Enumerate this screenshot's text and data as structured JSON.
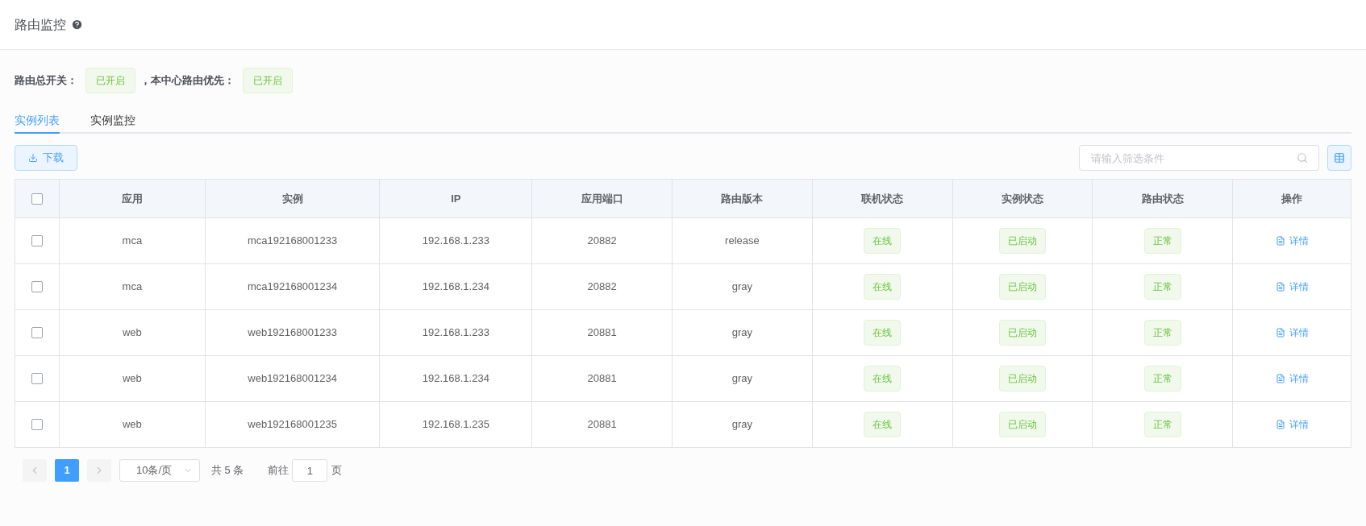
{
  "page": {
    "title": "路由监控"
  },
  "switches": [
    {
      "label": "路由总开关：",
      "value": "已开启"
    },
    {
      "label": "，本中心路由优先：",
      "value": "已开启"
    }
  ],
  "tabs": [
    {
      "label": "实例列表",
      "selected": true
    },
    {
      "label": "实例监控",
      "selected": false
    }
  ],
  "toolbar": {
    "download": "下载",
    "search": {
      "placeholder": "请输入筛选条件"
    }
  },
  "table": {
    "select_all": {
      "checked": false
    },
    "columns": [
      "应用",
      "实例",
      "IP",
      "应用端口",
      "路由版本",
      "联机状态",
      "实例状态",
      "路由状态",
      "操作"
    ],
    "rows": [
      {
        "checked": false,
        "cells": [
          "mca",
          "mca192168001233",
          "192.168.1.233",
          "20882",
          "release"
        ],
        "tags": [
          "在线",
          "已启动",
          "正常"
        ],
        "action": "详情"
      },
      {
        "checked": false,
        "cells": [
          "mca",
          "mca192168001234",
          "192.168.1.234",
          "20882",
          "gray"
        ],
        "tags": [
          "在线",
          "已启动",
          "正常"
        ],
        "action": "详情"
      },
      {
        "checked": false,
        "cells": [
          "web",
          "web192168001233",
          "192.168.1.233",
          "20881",
          "gray"
        ],
        "tags": [
          "在线",
          "已启动",
          "正常"
        ],
        "action": "详情"
      },
      {
        "checked": false,
        "cells": [
          "web",
          "web192168001234",
          "192.168.1.234",
          "20881",
          "gray"
        ],
        "tags": [
          "在线",
          "已启动",
          "正常"
        ],
        "action": "详情"
      },
      {
        "checked": false,
        "cells": [
          "web",
          "web192168001235",
          "192.168.1.235",
          "20881",
          "gray"
        ],
        "tags": [
          "在线",
          "已启动",
          "正常"
        ],
        "action": "详情"
      }
    ]
  },
  "pagination": {
    "pages": [
      {
        "label": "1",
        "selected": true
      }
    ],
    "page_size": "10条/页",
    "total": "共 5 条",
    "goto_label": "前往",
    "goto_value": "1",
    "goto_suffix": "页"
  }
}
